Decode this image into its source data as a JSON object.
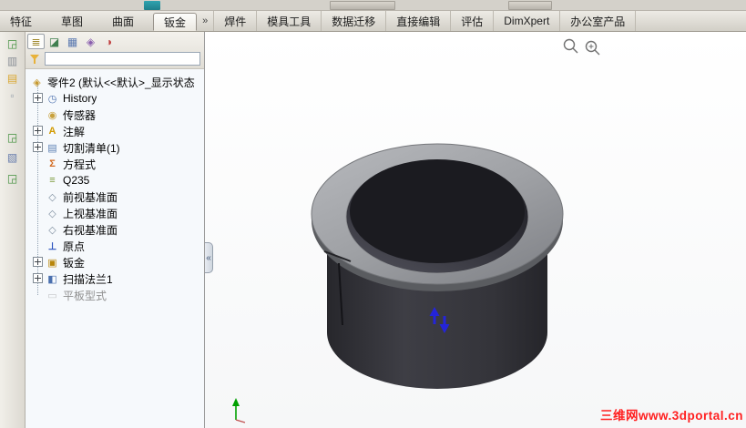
{
  "ribbon": {
    "tabs": [
      {
        "label": "特征",
        "active": false
      },
      {
        "label": "草图",
        "active": false
      },
      {
        "label": "曲面",
        "active": false
      },
      {
        "label": "钣金",
        "active": true
      },
      {
        "label": "焊件",
        "active": false
      },
      {
        "label": "模具工具",
        "active": false
      },
      {
        "label": "数据迁移",
        "active": false
      },
      {
        "label": "直接编辑",
        "active": false
      },
      {
        "label": "评估",
        "active": false
      },
      {
        "label": "DimXpert",
        "active": false
      },
      {
        "label": "办公室产品",
        "active": false
      }
    ],
    "overflow_chevron": "»"
  },
  "left_toolbar": {
    "icons": [
      "sketch-icon",
      "dimension-icon",
      "open-folder-icon",
      "note-icon",
      "sketch-corner-icon",
      "clipboard-icon",
      "sketch-corner-icon-2"
    ]
  },
  "panel": {
    "header_tabs": [
      {
        "icon": "featuremanager-tree-icon",
        "active": true
      },
      {
        "icon": "propertymanager-icon",
        "active": false
      },
      {
        "icon": "configurationmanager-icon",
        "active": false
      },
      {
        "icon": "dimxpertmanager-icon",
        "active": false
      },
      {
        "icon": "displaymanager-icon",
        "active": false
      }
    ],
    "filter": {
      "value": "",
      "icon": "filter-funnel-icon"
    },
    "collapse_chevron": "«",
    "tree": {
      "root": {
        "label": "零件2 (默认<<默认>_显示状态",
        "icon": "part-icon"
      },
      "items": [
        {
          "label": "History",
          "icon": "history-folder-icon",
          "expandable": true
        },
        {
          "label": "传感器",
          "icon": "sensors-icon",
          "expandable": false
        },
        {
          "label": "注解",
          "icon": "annotations-icon",
          "expandable": true
        },
        {
          "label": "切割清单(1)",
          "icon": "cut-list-icon",
          "expandable": true
        },
        {
          "label": "方程式",
          "icon": "equations-icon",
          "expandable": false
        },
        {
          "label": "Q235",
          "icon": "material-icon",
          "expandable": false
        },
        {
          "label": "前视基准面",
          "icon": "plane-icon",
          "expandable": false
        },
        {
          "label": "上视基准面",
          "icon": "plane-icon",
          "expandable": false
        },
        {
          "label": "右视基准面",
          "icon": "plane-icon",
          "expandable": false
        },
        {
          "label": "原点",
          "icon": "origin-icon",
          "expandable": false
        },
        {
          "label": "钣金",
          "icon": "sheet-metal-folder-icon",
          "expandable": true
        },
        {
          "label": "扫描法兰1",
          "icon": "swept-flange-icon",
          "expandable": true
        },
        {
          "label": "平板型式",
          "icon": "flat-pattern-icon",
          "expandable": false,
          "disabled": true
        }
      ]
    }
  },
  "viewport": {
    "watermark": "三维网www.3dportal.cn",
    "model": "sheet-metal-rolled-cylinder-with-flange",
    "zoom_icons": [
      "magnifier-icon",
      "magnifier-plus-icon"
    ],
    "colors": {
      "flange": "#9fa1a5",
      "body": "#35353b",
      "hole": "#1b1b20",
      "bend_arrow": "#2424d8",
      "origin_axis": "#00a000",
      "watermark": "#ff2020"
    }
  }
}
